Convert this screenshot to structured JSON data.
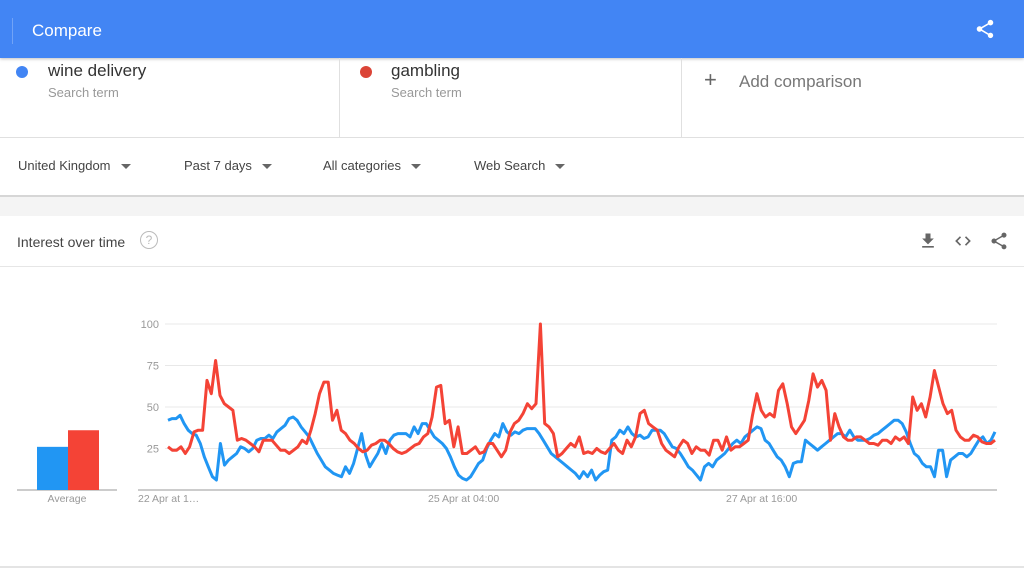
{
  "header": {
    "title": "Compare",
    "share_icon": "share-icon"
  },
  "terms": [
    {
      "name": "wine delivery",
      "subtitle": "Search term",
      "color": "#4285f4"
    },
    {
      "name": "gambling",
      "subtitle": "Search term",
      "color": "#db4437"
    }
  ],
  "add_comparison": {
    "icon": "plus-icon",
    "label": "Add comparison"
  },
  "filters": [
    {
      "label": "United Kingdom"
    },
    {
      "label": "Past 7 days"
    },
    {
      "label": "All categories"
    },
    {
      "label": "Web Search"
    }
  ],
  "card": {
    "title": "Interest over time",
    "help_icon": "?",
    "actions": [
      "download-icon",
      "embed-icon",
      "share-icon"
    ]
  },
  "chart_data": {
    "type": "line",
    "title": "Interest over time",
    "ylim": [
      0,
      100
    ],
    "yticks": [
      25,
      50,
      75,
      100
    ],
    "xtick_labels": [
      "22 Apr at 1…",
      "25 Apr at 04:00",
      "27 Apr at 16:00"
    ],
    "grid": true,
    "averages": {
      "label": "Average",
      "values": [
        26,
        36
      ]
    },
    "series": [
      {
        "name": "wine delivery",
        "color": "#2196f3",
        "values": [
          42,
          43,
          43,
          45,
          40,
          36,
          34,
          33,
          28,
          20,
          14,
          8,
          6,
          28,
          15,
          18,
          20,
          22,
          26,
          25,
          23,
          25,
          30,
          31,
          31,
          33,
          31,
          35,
          37,
          39,
          43,
          44,
          42,
          38,
          35,
          32,
          27,
          22,
          18,
          14,
          12,
          10,
          9,
          8,
          14,
          10,
          16,
          25,
          34,
          21,
          14,
          18,
          22,
          28,
          22,
          30,
          33,
          34,
          34,
          34,
          32,
          38,
          34,
          40,
          40,
          36,
          32,
          30,
          28,
          25,
          20,
          14,
          9,
          7,
          6,
          8,
          12,
          16,
          18,
          25,
          30,
          34,
          32,
          40,
          35,
          33,
          35,
          34,
          36,
          37,
          37,
          37,
          34,
          30,
          26,
          22,
          20,
          18,
          16,
          14,
          12,
          10,
          7,
          11,
          8,
          12,
          6,
          9,
          11,
          12,
          30,
          32,
          36,
          34,
          38,
          34,
          32,
          33,
          31,
          32,
          36,
          36,
          36,
          34,
          30,
          26,
          25,
          22,
          18,
          14,
          12,
          9,
          6,
          14,
          16,
          14,
          18,
          20,
          22,
          25,
          28,
          30,
          28,
          32,
          34,
          36,
          38,
          37,
          30,
          28,
          24,
          20,
          18,
          14,
          8,
          16,
          17,
          17,
          30,
          28,
          26,
          24,
          26,
          28,
          30,
          32,
          34,
          34,
          32,
          36,
          32,
          30,
          30,
          30,
          31,
          33,
          34,
          36,
          38,
          40,
          42,
          42,
          40,
          35,
          28,
          22,
          20,
          16,
          14,
          14,
          8,
          24,
          24,
          8,
          18,
          20,
          22,
          22,
          20,
          22,
          26,
          30,
          32,
          28,
          30,
          35
        ]
      },
      {
        "name": "gambling",
        "color": "#f44336",
        "values": [
          26,
          24,
          24,
          26,
          22,
          26,
          35,
          36,
          36,
          66,
          58,
          78,
          57,
          52,
          50,
          48,
          30,
          31,
          30,
          28,
          26,
          23,
          30,
          30,
          30,
          27,
          24,
          24,
          22,
          24,
          26,
          30,
          28,
          36,
          46,
          58,
          65,
          65,
          42,
          48,
          36,
          34,
          30,
          28,
          25,
          23,
          24,
          27,
          28,
          30,
          30,
          28,
          25,
          23,
          22,
          23,
          25,
          27,
          28,
          32,
          34,
          44,
          62,
          63,
          40,
          42,
          26,
          38,
          22,
          22,
          24,
          26,
          22,
          23,
          28,
          28,
          24,
          20,
          24,
          35,
          40,
          42,
          46,
          52,
          49,
          52,
          100,
          40,
          38,
          34,
          20,
          22,
          25,
          28,
          26,
          32,
          22,
          23,
          22,
          25,
          23,
          22,
          25,
          28,
          24,
          22,
          30,
          26,
          32,
          46,
          48,
          40,
          38,
          36,
          28,
          24,
          22,
          20,
          26,
          30,
          28,
          22,
          26,
          24,
          24,
          21,
          30,
          30,
          24,
          32,
          24,
          26,
          26,
          28,
          30,
          45,
          58,
          48,
          44,
          46,
          44,
          60,
          64,
          52,
          38,
          34,
          38,
          42,
          54,
          70,
          62,
          66,
          60,
          30,
          46,
          38,
          32,
          30,
          30,
          32,
          32,
          30,
          28,
          28,
          27,
          30,
          30,
          28,
          32,
          30,
          32,
          28,
          56,
          48,
          52,
          44,
          56,
          72,
          62,
          52,
          46,
          48,
          36,
          32,
          30,
          30,
          33,
          32,
          29,
          28,
          28,
          30
        ]
      }
    ]
  }
}
